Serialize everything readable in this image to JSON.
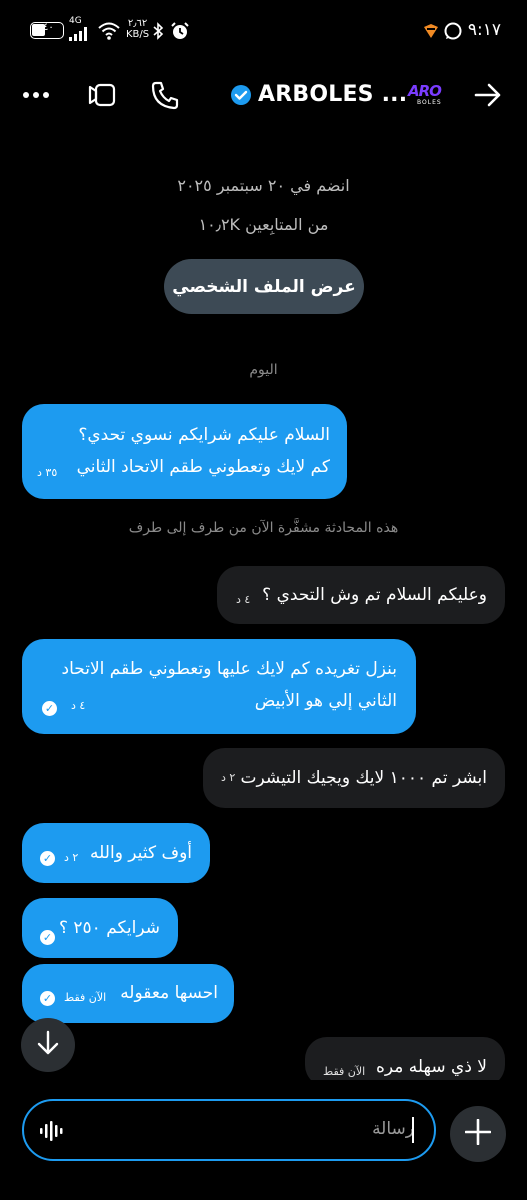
{
  "status_bar": {
    "time": "٩:١٧",
    "net_speed_value": "٢٫٦٢",
    "net_speed_unit": "KB/S",
    "network_type": "4G",
    "battery_level": "٤٠"
  },
  "header": {
    "title": "ARBOLES ...",
    "logo_text": "ARO",
    "logo_sub": "BOLES"
  },
  "profile_info": {
    "joined": "انضم في ٢٠ سبتمبر ٢٠٢٥",
    "followers": "١٠٫٢K من المتابِعين",
    "view_profile_label": "عرض الملف الشخصي"
  },
  "day_label": "اليوم",
  "encryption_notice": "هذه المحادثة مشفَّرة الآن من طرف إلى طرف",
  "messages": [
    {
      "lines": [
        "السلام عليكم شرايكم نسوي تحدي؟",
        "كم لايك وتعطوني طقم الاتحاد الثاني"
      ],
      "time": "٣٥ د"
    },
    {
      "lines": [
        "وعليكم السلام تم وش التحدي ؟"
      ],
      "time": "٤ د"
    },
    {
      "lines": [
        "بنزل تغريده كم لايك عليها وتعطوني طقم الاتحاد",
        "الثاني إلي هو الأبيض"
      ],
      "time": "٤ د"
    },
    {
      "lines": [
        "ابشر تم ١٠٠٠ لايك ويجيك التيشرت"
      ],
      "time": "٢ د"
    },
    {
      "lines": [
        "أوف كثير والله"
      ],
      "time": "٢ د"
    },
    {
      "lines": [
        "شرايكم ٢٥٠ ؟"
      ],
      "time": ""
    },
    {
      "lines": [
        "احسها معقوله"
      ],
      "time": "الآن فقط"
    },
    {
      "lines": [
        "لا ذي سهله مره"
      ],
      "time": "الآن فقط"
    }
  ],
  "composer": {
    "placeholder": "رسالة"
  },
  "colors": {
    "accent": "#1d9bf0",
    "background": "#000000",
    "incoming_bubble": "#1c1d1f",
    "profile_button": "#3d4a55"
  }
}
